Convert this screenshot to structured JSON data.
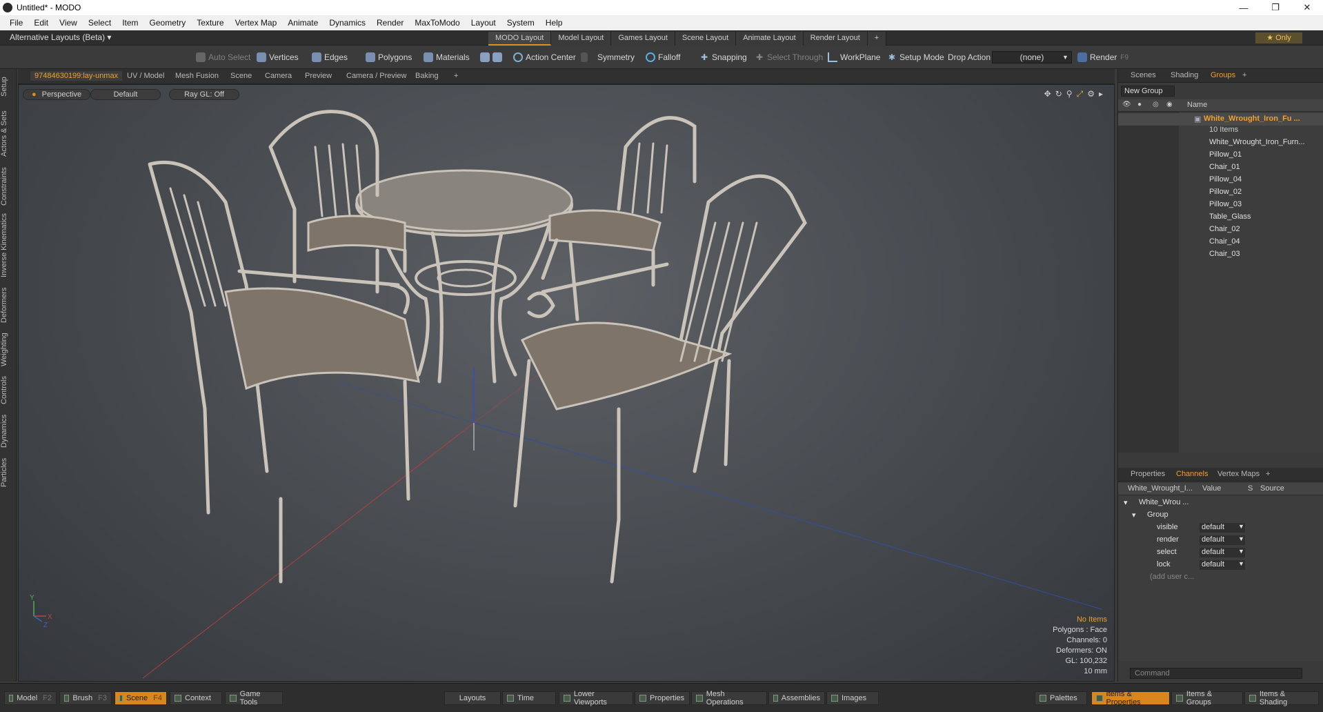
{
  "window": {
    "title": "Untitled* - MODO"
  },
  "menu": [
    "File",
    "Edit",
    "View",
    "Select",
    "Item",
    "Geometry",
    "Texture",
    "Vertex Map",
    "Animate",
    "Dynamics",
    "Render",
    "MaxToModo",
    "Layout",
    "System",
    "Help"
  ],
  "layouts": {
    "alt_label": "Alternative Layouts (Beta)",
    "tabs": [
      "MODO Layout",
      "Model Layout",
      "Games Layout",
      "Scene Layout",
      "Animate Layout",
      "Render Layout"
    ],
    "only_label": "Only"
  },
  "toolbar": {
    "auto_select": "Auto Select",
    "vertices": "Vertices",
    "edges": "Edges",
    "polygons": "Polygons",
    "materials": "Materials",
    "action_center": "Action Center",
    "symmetry": "Symmetry",
    "falloff": "Falloff",
    "snapping": "Snapping",
    "select_through": "Select Through",
    "workplane": "WorkPlane",
    "setup_mode": "Setup Mode",
    "drop_action": "Drop Action",
    "drop_value": "(none)",
    "render": "Render",
    "render_key": "F9"
  },
  "left_tabs": [
    "Setup",
    "Actors & Sets",
    "Constraints",
    "Inverse Kinematics",
    "Deformers",
    "Weighting",
    "Controls",
    "Dynamics",
    "Particles"
  ],
  "viewport_tabs": [
    "97484630199:lay-unmax",
    "UV / Model",
    "Mesh Fusion",
    "Scene",
    "Camera",
    "Preview",
    "Camera / Preview",
    "Baking"
  ],
  "viewport": {
    "view": "Perspective",
    "shading": "Default",
    "raygl": "Ray GL: Off",
    "info": {
      "items": "No Items",
      "polygons": "Polygons : Face",
      "channels": "Channels: 0",
      "deformers": "Deformers: ON",
      "gl": "GL: 100,232",
      "scale": "10 mm"
    },
    "axis_y": "Y",
    "axis_x": "X",
    "axis_z": "Z"
  },
  "right_top_tabs": [
    "Scenes",
    "Shading",
    "Groups"
  ],
  "groups": {
    "new_group": "New Group",
    "name_col": "Name",
    "group_name": "White_Wrought_Iron_Fu ...",
    "count": "10 Items",
    "items": [
      "White_Wrought_Iron_Furn...",
      "Pillow_01",
      "Chair_01",
      "Pillow_04",
      "Pillow_02",
      "Pillow_03",
      "Table_Glass",
      "Chair_02",
      "Chair_04",
      "Chair_03"
    ]
  },
  "right_bottom_tabs": [
    "Properties",
    "Channels",
    "Vertex Maps"
  ],
  "channels": {
    "headers": [
      "White_Wrought_I...",
      "Value",
      "S",
      "Source"
    ],
    "root": "White_Wrou ...",
    "group": "Group",
    "rows": [
      {
        "name": "visible",
        "value": "default"
      },
      {
        "name": "render",
        "value": "default"
      },
      {
        "name": "select",
        "value": "default"
      },
      {
        "name": "lock",
        "value": "default"
      }
    ],
    "add": "(add user c..."
  },
  "command": {
    "placeholder": "Command"
  },
  "bottombar": {
    "left": [
      {
        "label": "Model",
        "key": "F2"
      },
      {
        "label": "Brush",
        "key": "F3"
      },
      {
        "label": "Scene",
        "key": "F4"
      },
      {
        "label": "Context",
        "key": ""
      },
      {
        "label": "Game Tools",
        "key": ""
      }
    ],
    "middle": [
      "Layouts",
      "Time",
      "Lower Viewports",
      "Properties",
      "Mesh Operations",
      "Assemblies",
      "Images"
    ],
    "right": [
      "Palettes",
      "Items & Properties",
      "Items & Groups",
      "Items & Shading"
    ]
  },
  "colors": {
    "accent": "#e0901c",
    "wire": "#c9c2b8",
    "seat": "#8a7f74"
  }
}
